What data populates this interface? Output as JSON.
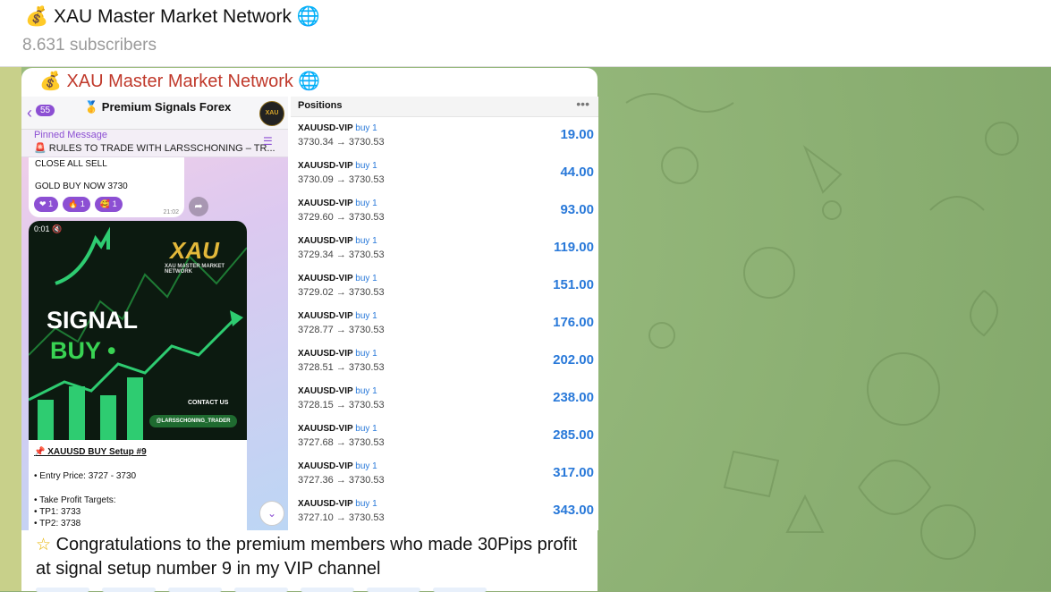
{
  "header": {
    "channel_title": "💰 XAU Master Market Network 🌐",
    "subscribers": "8.631 subscribers"
  },
  "message": {
    "author": "💰 XAU Master Market Network 🌐",
    "caption_icon": "star-icon",
    "caption": "Congratulations to the premium members who made 30Pips profit at signal setup number 9  in my VIP channel"
  },
  "phone": {
    "back_count": "55",
    "channel_name": "🥇 Premium Signals Forex",
    "avatar_text": "XAU",
    "pinned_label": "Pinned Message",
    "pinned_text": "🚨 RULES TO TRADE WITH LARSSCHONING – TR...",
    "bubble1_line1": "CLOSE ALL SELL",
    "bubble1_line2": "GOLD BUY NOW 3730",
    "reactions": [
      {
        "emoji": "❤",
        "count": "1"
      },
      {
        "emoji": "🔥",
        "count": "1"
      },
      {
        "emoji": "🥰",
        "count": "1"
      }
    ],
    "bubble1_time": "21:02",
    "video_time": "0:01 🔇",
    "video_logo": "XAU",
    "video_logo_sub": "XAU MASTER MARKET NETWORK",
    "video_signal": "SIGNAL",
    "video_buy": "BUY •",
    "video_contact": "CONTACT US",
    "video_handle": "@LARSSCHONING_TRADER",
    "setup_title": "📌 XAUUSD BUY Setup #9",
    "entry": "• Entry Price: 3727 - 3730",
    "tp_header": "• Take Profit Targets:",
    "tp1": "• TP1: 3733",
    "tp2": "• TP2: 3738"
  },
  "positions": {
    "title": "Positions",
    "menu": "•••",
    "rows": [
      {
        "symbol": "XAUUSD-VIP",
        "side": "buy 1",
        "prices": "3730.34 → 3730.53",
        "profit": "19.00"
      },
      {
        "symbol": "XAUUSD-VIP",
        "side": "buy 1",
        "prices": "3730.09 → 3730.53",
        "profit": "44.00"
      },
      {
        "symbol": "XAUUSD-VIP",
        "side": "buy 1",
        "prices": "3729.60 → 3730.53",
        "profit": "93.00"
      },
      {
        "symbol": "XAUUSD-VIP",
        "side": "buy 1",
        "prices": "3729.34 → 3730.53",
        "profit": "119.00"
      },
      {
        "symbol": "XAUUSD-VIP",
        "side": "buy 1",
        "prices": "3729.02 → 3730.53",
        "profit": "151.00"
      },
      {
        "symbol": "XAUUSD-VIP",
        "side": "buy 1",
        "prices": "3728.77 → 3730.53",
        "profit": "176.00"
      },
      {
        "symbol": "XAUUSD-VIP",
        "side": "buy 1",
        "prices": "3728.51 → 3730.53",
        "profit": "202.00"
      },
      {
        "symbol": "XAUUSD-VIP",
        "side": "buy 1",
        "prices": "3728.15 → 3730.53",
        "profit": "238.00"
      },
      {
        "symbol": "XAUUSD-VIP",
        "side": "buy 1",
        "prices": "3727.68 → 3730.53",
        "profit": "285.00"
      },
      {
        "symbol": "XAUUSD-VIP",
        "side": "buy 1",
        "prices": "3727.36 → 3730.53",
        "profit": "317.00"
      },
      {
        "symbol": "XAUUSD-VIP",
        "side": "buy 1",
        "prices": "3727.10 → 3730.53",
        "profit": "343.00"
      }
    ]
  },
  "colors": {
    "accent": "#2979d9",
    "author": "#c0392b",
    "telegram_purple": "#8c4fd3",
    "chat_background": "#8fae75"
  }
}
